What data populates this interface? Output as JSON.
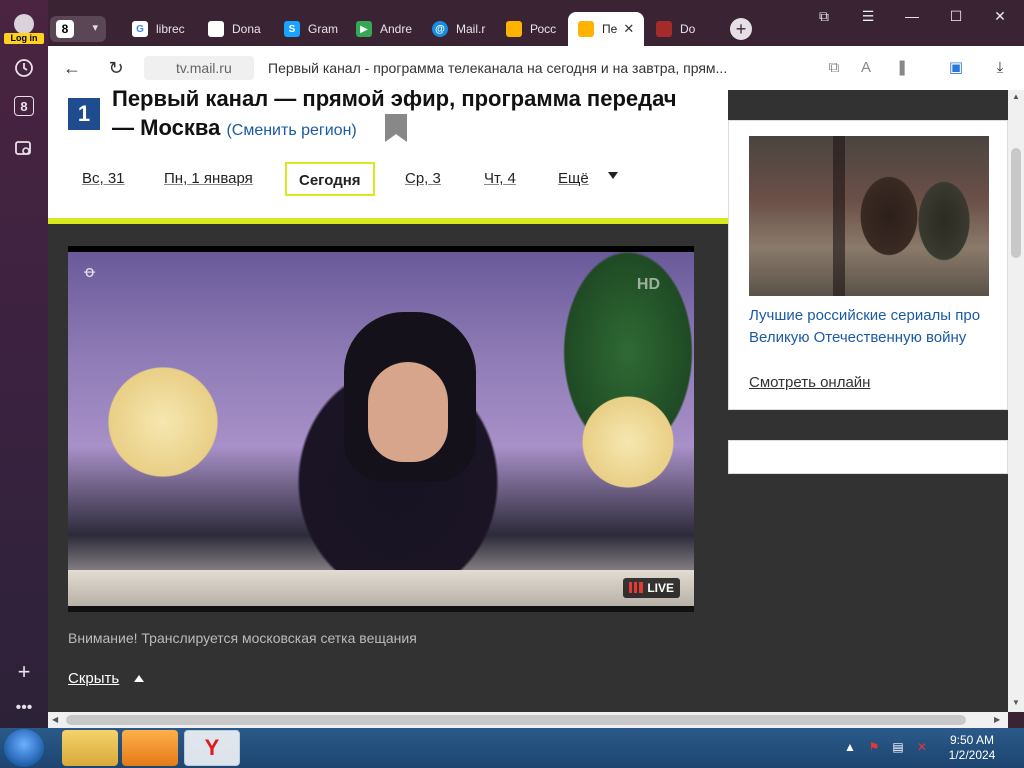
{
  "sidebar": {
    "login_label": "Log in",
    "counter": "8",
    "items": [
      {
        "icon": "history-icon"
      },
      {
        "icon": "counter-icon",
        "label": "8"
      },
      {
        "icon": "screenshot-icon"
      }
    ]
  },
  "tabs": {
    "count": "8",
    "items": [
      {
        "label": "librec",
        "icon": "google-icon",
        "color": "#4285f4"
      },
      {
        "label": "Dona",
        "icon": "document-icon",
        "color": "#ffffff"
      },
      {
        "label": "Gram",
        "icon": "translate-icon",
        "color": "#1aa3ff"
      },
      {
        "label": "Andre",
        "icon": "play-store-icon",
        "color": "#34a853"
      },
      {
        "label": "Mail.r",
        "icon": "mail-icon",
        "color": "#168de2"
      },
      {
        "label": "Росс",
        "icon": "tv-icon",
        "color": "#ffb300"
      },
      {
        "label": "Пе",
        "icon": "tv-icon",
        "color": "#ffb300",
        "active": true
      },
      {
        "label": "Do",
        "icon": "game-icon",
        "color": "#a52a2a"
      }
    ]
  },
  "address": {
    "url": "tv.mail.ru",
    "title": "Первый канал - программа телеканала на сегодня и на завтра, прям..."
  },
  "header": {
    "logo_char": "1",
    "title": "Первый канал — прямой эфир, программа передач — Москва",
    "change_region": "(Сменить регион)"
  },
  "days": [
    {
      "label": "Вс, 31"
    },
    {
      "label": "Пн, 1 января"
    },
    {
      "label": "Сегодня",
      "active": true
    },
    {
      "label": "Ср, 3"
    },
    {
      "label": "Чт, 4"
    },
    {
      "label": "Ещё"
    }
  ],
  "video": {
    "hd_badge": "HD",
    "live_label": "LIVE"
  },
  "notice": "Внимание! Транслируется московская сетка вещания",
  "hide_label": "Скрыть",
  "promo": {
    "title": "Лучшие российские сериалы про Великую Отечественную войну",
    "link": "Смотреть онлайн"
  },
  "taskbar": {
    "time": "9:50 AM",
    "date": "1/2/2024"
  }
}
